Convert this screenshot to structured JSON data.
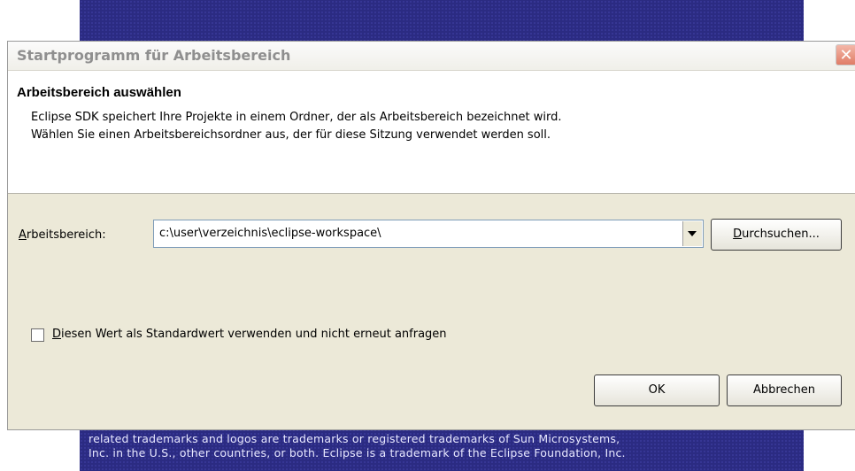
{
  "splash": {
    "text_line1": "related trademarks and logos are trademarks or registered trademarks of Sun Microsystems,",
    "text_line2": "Inc. in the U.S., other countries, or both. Eclipse is a trademark of the Eclipse Foundation, Inc."
  },
  "dialog": {
    "title": "Startprogramm für Arbeitsbereich",
    "close_icon": "close-icon",
    "banner": {
      "heading": "Arbeitsbereich auswählen",
      "line1": "Eclipse SDK speichert Ihre Projekte in einem Ordner, der als Arbeitsbereich bezeichnet wird.",
      "line2": "Wählen Sie einen Arbeitsbereichsordner aus, der für diese Sitzung verwendet werden soll."
    },
    "workspace": {
      "label_mnemonic": "A",
      "label_rest": "rbeitsbereich:",
      "value": "c:\\user\\verzeichnis\\eclipse-workspace\\",
      "browse_mnemonic": "D",
      "browse_rest": "urchsuchen..."
    },
    "default_checkbox": {
      "checked": false,
      "label_mnemonic": "D",
      "label_rest": "iesen Wert als Standardwert verwenden und nicht erneut anfragen"
    },
    "buttons": {
      "ok": "OK",
      "cancel": "Abbrechen"
    },
    "colors": {
      "dialog_bg": "#ece9d8",
      "splash_bg": "#2b2b82",
      "close_button": "#e07c66"
    }
  }
}
